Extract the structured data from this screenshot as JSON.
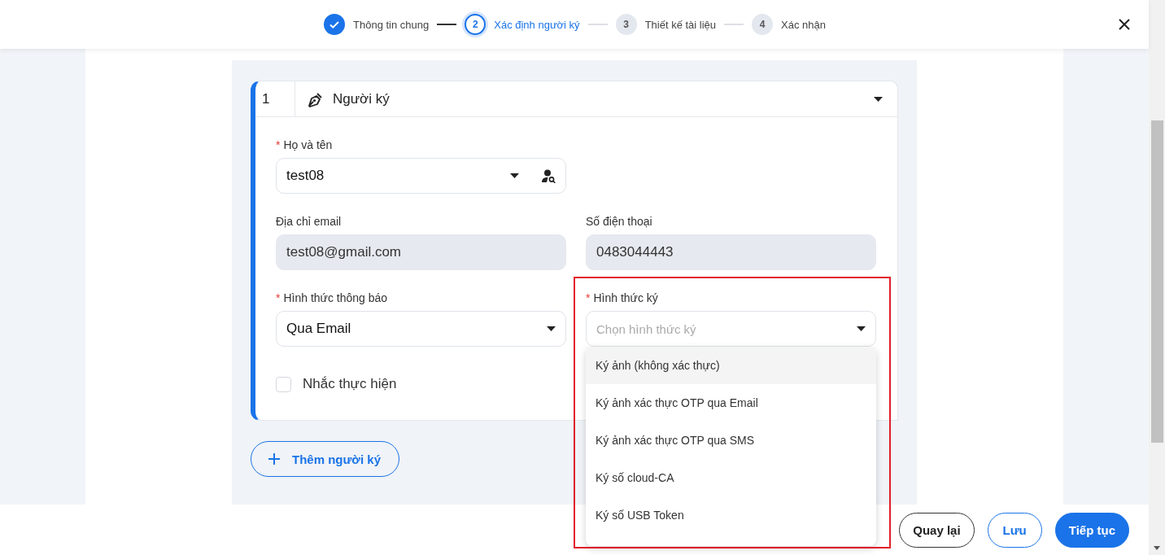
{
  "stepper": [
    {
      "label": "Thông tin chung",
      "done": true,
      "selected": false
    },
    {
      "number": "2",
      "label": "Xác định người ký",
      "done": false,
      "selected": true
    },
    {
      "number": "3",
      "label": "Thiết kế tài liệu",
      "done": false,
      "selected": false
    },
    {
      "number": "4",
      "label": "Xác nhận",
      "done": false,
      "selected": false
    }
  ],
  "signers": [
    {
      "index": "1",
      "title": "Người ký",
      "expanded": true,
      "fields": [
        {
          "kind": "lookup",
          "label": "Họ và tên",
          "required_mark": "*",
          "value": "test08"
        },
        {
          "kind": "blank"
        },
        {
          "kind": "readonly",
          "label": "Địa chỉ email",
          "value": "test08@gmail.com"
        },
        {
          "kind": "readonly",
          "label": "Số điện thoại",
          "value": "0483044443"
        },
        {
          "kind": "select",
          "label": "Hình thức thông báo",
          "required_mark": "*",
          "value": "Qua Email"
        },
        {
          "kind": "select",
          "label": "Hình thức ký",
          "required_mark": "*",
          "placeholder": "Chọn hình thức ký",
          "expanded": true,
          "highlighted": true,
          "options": [
            {
              "label": "Ký ảnh (không xác thực)",
              "selected": true
            },
            {
              "label": "Ký ảnh xác thực OTP qua Email",
              "selected": false
            },
            {
              "label": "Ký ảnh xác thực OTP qua SMS",
              "selected": false
            },
            {
              "label": "Ký số cloud-CA",
              "selected": false
            },
            {
              "label": "Ký số USB Token",
              "selected": false
            }
          ]
        }
      ],
      "reminder": {
        "label": "Nhắc thực hiện",
        "checked": false
      }
    }
  ],
  "add_button": "Thêm người ký",
  "footer_buttons": [
    {
      "label": "Quay lại",
      "kind": "outline"
    },
    {
      "label": "Lưu",
      "kind": "outline-primary"
    },
    {
      "label": "Tiếp tục",
      "kind": "primary"
    }
  ]
}
